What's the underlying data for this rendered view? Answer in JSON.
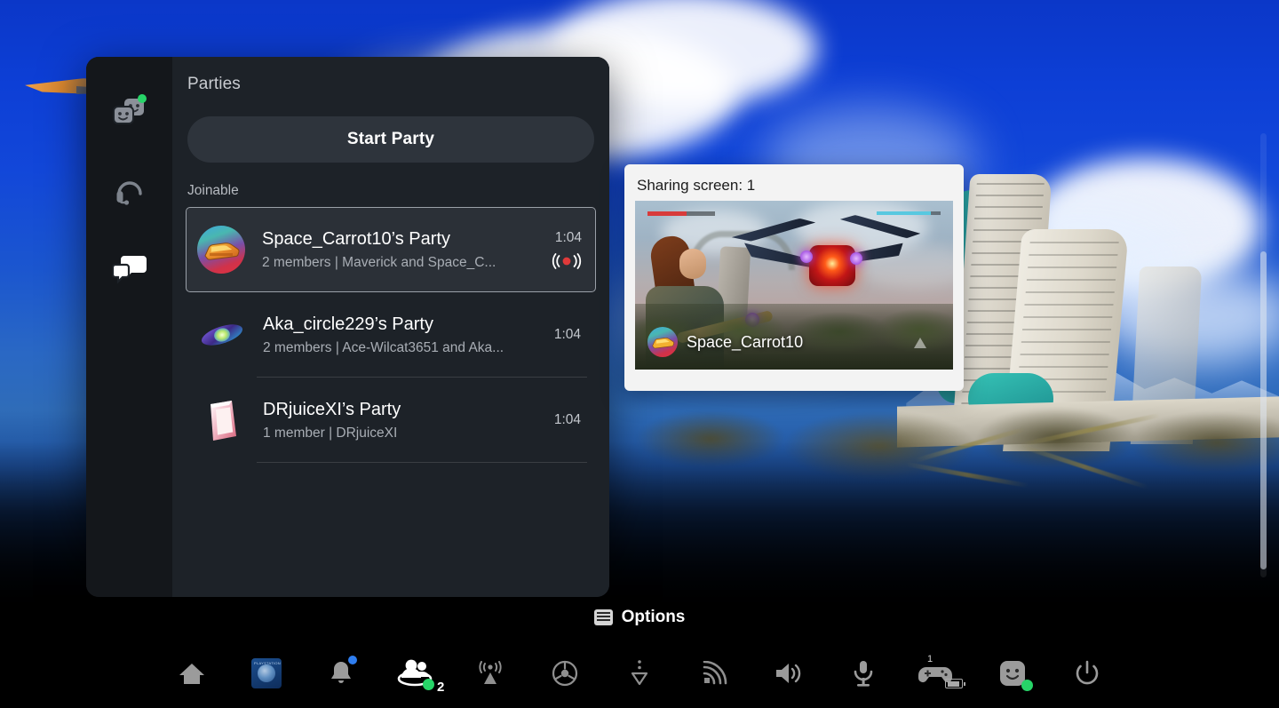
{
  "panel": {
    "title": "Parties",
    "start_party_label": "Start Party",
    "section_label": "Joinable",
    "rail": [
      {
        "name": "parties",
        "icon": "parties-icon",
        "has_status_dot": true,
        "active": false
      },
      {
        "name": "headset",
        "icon": "headset-icon",
        "has_status_dot": false,
        "active": false
      },
      {
        "name": "messages",
        "icon": "messages-icon",
        "has_status_dot": false,
        "active": true
      }
    ],
    "parties": [
      {
        "title": "Space_Carrot10’s Party",
        "subtitle": "2 members | Maverick and Space_C...",
        "time": "1:04",
        "selected": true,
        "broadcasting": true,
        "avatar": "car-avatar"
      },
      {
        "title": "Aka_circle229’s Party",
        "subtitle": "2 members | Ace-Wilcat3651 and Aka...",
        "time": "1:04",
        "selected": false,
        "broadcasting": false,
        "avatar": "galaxy-avatar"
      },
      {
        "title": "DRjuiceXI’s Party",
        "subtitle": "1 member | DRjuiceXI",
        "time": "1:04",
        "selected": false,
        "broadcasting": false,
        "avatar": "frame-avatar"
      }
    ]
  },
  "share_card": {
    "title": "Sharing screen: 1",
    "player_name": "Space_Carrot10"
  },
  "options": {
    "label": "Options"
  },
  "taskbar": {
    "items": [
      {
        "name": "home",
        "icon": "home-icon"
      },
      {
        "name": "playstation-app",
        "icon": "playstation-tile-icon",
        "tile_word": "PLAYSTATION"
      },
      {
        "name": "notifications",
        "icon": "bell-icon",
        "badge": "blue-dot"
      },
      {
        "name": "game-base",
        "icon": "party-people-icon",
        "count": "2",
        "status": "green-dot"
      },
      {
        "name": "broadcast",
        "icon": "broadcast-icon"
      },
      {
        "name": "accessibility",
        "icon": "accessibility-icon"
      },
      {
        "name": "downloads",
        "icon": "downloads-icon"
      },
      {
        "name": "network",
        "icon": "network-icon"
      },
      {
        "name": "sound",
        "icon": "volume-icon"
      },
      {
        "name": "microphone",
        "icon": "microphone-icon"
      },
      {
        "name": "controller",
        "icon": "controller-icon",
        "controller_number": "1",
        "battery": "battery-icon"
      },
      {
        "name": "profile",
        "icon": "profile-avatar-icon",
        "status": "green-dot"
      },
      {
        "name": "power",
        "icon": "power-icon"
      }
    ]
  },
  "colors": {
    "accent_green": "#27d468",
    "accent_blue": "#2f7ef0",
    "live_red": "#e03a3a",
    "panel_bg": "#1d2228",
    "rail_bg": "#14171b",
    "card_bg": "#f3f3f3",
    "background_sky": "#0d3fd6"
  }
}
